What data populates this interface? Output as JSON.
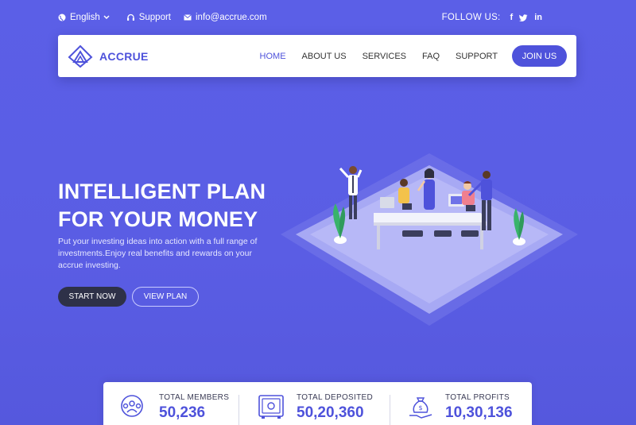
{
  "topbar": {
    "language": "English",
    "support": "Support",
    "email": "info@accrue.com",
    "follow_label": "FOLLOW US:",
    "social": [
      "f",
      "t-icon",
      "in"
    ]
  },
  "brand": {
    "name": "ACCRUE"
  },
  "nav": {
    "items": [
      {
        "label": "HOME"
      },
      {
        "label": "ABOUT US"
      },
      {
        "label": "SERVICES"
      },
      {
        "label": "FAQ"
      },
      {
        "label": "SUPPORT"
      }
    ],
    "join_label": "JOIN US"
  },
  "hero": {
    "title_line1": "INTELLIGENT PLAN",
    "title_line2": "FOR YOUR MONEY",
    "description": "Put your investing ideas into action with a full range of investments.Enjoy real benefits and rewards on your accrue investing.",
    "start_label": "START NOW",
    "view_label": "VIEW PLAN"
  },
  "stats": [
    {
      "label": "TOTAL MEMBERS",
      "value": "50,236",
      "icon": "members-icon"
    },
    {
      "label": "TOTAL DEPOSITED",
      "value": "50,20,360",
      "icon": "safe-icon"
    },
    {
      "label": "TOTAL PROFITS",
      "value": "10,30,136",
      "icon": "money-bag-icon"
    }
  ],
  "colors": {
    "primary": "#4e52db",
    "background": "#5a5ee6",
    "dark_button": "#2e3148"
  }
}
